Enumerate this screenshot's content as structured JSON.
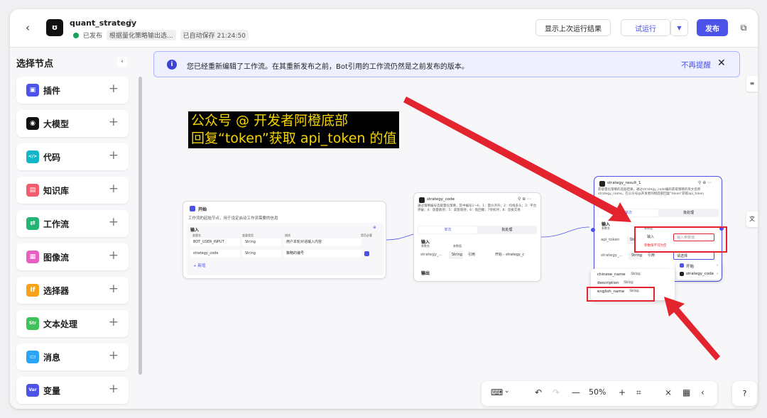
{
  "topbar": {
    "back_icon": "‹",
    "title": "quant_strategy",
    "status": "已发布",
    "desc": "根据量化策略输出选...",
    "autosave": "已自动保存 21:24:50",
    "show_last_run": "显示上次运行结果",
    "test_run": "试运行",
    "publish": "发布"
  },
  "sidebar": {
    "title": "选择节点",
    "items": [
      {
        "label": "插件",
        "icon": "plugin-icon",
        "color": "#4d53e8",
        "glyph": "▣"
      },
      {
        "label": "大模型",
        "icon": "llm-icon",
        "color": "#111111",
        "glyph": "◉"
      },
      {
        "label": "代码",
        "icon": "code-icon",
        "color": "#12b7c7",
        "glyph": "</>"
      },
      {
        "label": "知识库",
        "icon": "knowledge-icon",
        "color": "#f25c6b",
        "glyph": "▤"
      },
      {
        "label": "工作流",
        "icon": "workflow-icon",
        "color": "#22b573",
        "glyph": "⇄"
      },
      {
        "label": "图像流",
        "icon": "imageflow-icon",
        "color": "#e85fc4",
        "glyph": "▦"
      },
      {
        "label": "选择器",
        "icon": "selector-icon",
        "color": "#f7a21b",
        "glyph": "If"
      },
      {
        "label": "文本处理",
        "icon": "text-icon",
        "color": "#3fc25b",
        "glyph": "Str"
      },
      {
        "label": "消息",
        "icon": "message-icon",
        "color": "#2aa4f4",
        "glyph": "▭"
      },
      {
        "label": "变量",
        "icon": "variable-icon",
        "color": "#4d53e8",
        "glyph": "Var"
      }
    ]
  },
  "notice": {
    "text": "您已经重新编辑了工作流。在其重新发布之前，Bot引用的工作流仍然是之前发布的版本。",
    "dismiss": "不再提醒"
  },
  "annotation": {
    "line1": "公众号 @ 开发者阿橙底部",
    "line2": "回复“token”获取 api_token 的值"
  },
  "node_start": {
    "title": "开始",
    "desc": "工作流的起始节点，用于设定启动工作流需要的信息",
    "section": "输入",
    "cols": [
      "变量名",
      "变量类型",
      "描述",
      "是否必要"
    ],
    "rows": [
      {
        "name": "BOT_USER_INPUT",
        "type": "String",
        "desc": "用户本轮对话输入内容"
      },
      {
        "name": "strategy_code",
        "type": "String",
        "desc": "策略的编号"
      }
    ],
    "add": "+ 新增"
  },
  "node_code": {
    "title": "strategy_code",
    "desc": "通过策略编号选取量化策略，其中编号1～6，1：量价齐升；2：均线多头；3：平台突破；4：放量跌停；5：高管增持；6：低回撤；7停机坪；8：首板交易",
    "tab1": "单次",
    "tab2": "批处理",
    "section": "输入",
    "col_name": "参数名",
    "col_val": "参数值",
    "param": "strategy_...",
    "ptype": "String",
    "ref": "引用",
    "refval": "开始 - strategy_c",
    "output": "输出"
  },
  "node_result": {
    "title": "strategy_result_1",
    "desc": "获取量化策略的选股结果，通过strategy_code编码获取策略的英文名称strategy_name。在公众号@开发者阿橙底部回复“token”获取api_token",
    "tab1": "单次",
    "tab2": "批处理",
    "section": "输入",
    "col_name": "参数名",
    "col_val": "参数值",
    "p1": "api_token",
    "p1type": "String",
    "p1mode": "输入",
    "p1placeholder": "输入参数值",
    "p1err": "参数值不可为空",
    "p2": "strategy_...",
    "p2type": "String",
    "p2mode": "引用",
    "p2select": "请选择"
  },
  "popup_nodes": {
    "start": "开始",
    "code": "strategy_code"
  },
  "popup_fields": [
    {
      "name": "chinese_name",
      "type": "String"
    },
    {
      "name": "description",
      "type": "String"
    },
    {
      "name": "english_name",
      "type": "String"
    }
  ],
  "toolbar": {
    "zoom": "50%"
  },
  "colors": {
    "accent": "#4d53e8",
    "annotation_red": "#e3232d"
  }
}
